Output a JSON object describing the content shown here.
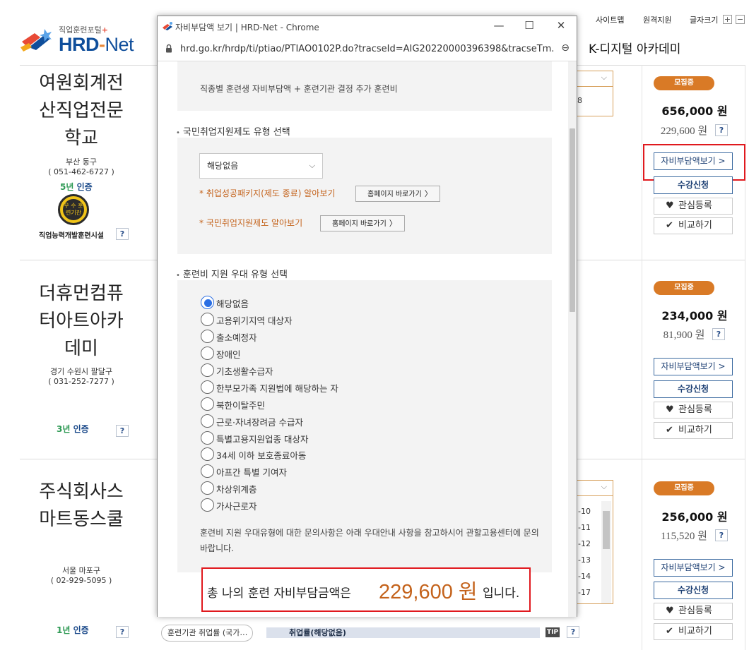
{
  "topbar": {
    "sitemap": "사이트맵",
    "remote": "원격지원",
    "fontsize": "글자크기",
    "plus": "+",
    "minus": "−"
  },
  "logo": {
    "sub": "직업훈련포털",
    "sub_plus": "+",
    "main_a": "HRD",
    "main_dash": "-",
    "main_b": "Net"
  },
  "header_right_title": "K-디지털 아카데미",
  "institutions": [
    {
      "name": "여원회계전산직업전문학교",
      "addr1": "부산 동구",
      "addr2": "( 051-462-6727 )",
      "cert_num": "5년",
      "cert_txt": " 인증",
      "medal_text": "우 수 훈련기관",
      "facility": "직업능력개발훈련시설",
      "q": "?"
    },
    {
      "name": "더휴먼컴퓨터아트아카데미",
      "addr1": "경기 수원시 팔달구",
      "addr2": "( 031-252-7277 )",
      "cert_num": "3년",
      "cert_txt": " 인증",
      "q": "?"
    },
    {
      "name": "주식회사스마트동스쿨",
      "addr1": "서울 마포구",
      "addr2": "( 02-929-5095 )",
      "cert_num": "1년",
      "cert_txt": " 인증",
      "q": "?"
    }
  ],
  "inst_names_lines": [
    [
      "여원회계전",
      "산직업전문",
      "학교"
    ],
    [
      "더휴먼컴퓨",
      "터아트아카",
      "데미"
    ],
    [
      "주식회사스",
      "마트동스쿨"
    ]
  ],
  "courses": [
    {
      "status": "모집중",
      "price": "656,000 원",
      "self_price": "229,600 원",
      "q": "?",
      "btn_view": "자비부담액보기 >",
      "btn_apply": "수강신청",
      "btn_like": "관심등록",
      "btn_compare": "비교하기"
    },
    {
      "status": "모집중",
      "price": "234,000 원",
      "self_price": "81,900 원",
      "q": "?",
      "btn_view": "자비부담액보기 >",
      "btn_apply": "수강신청",
      "btn_like": "관심등록",
      "btn_compare": "비교하기"
    },
    {
      "status": "모집중",
      "price": "256,000 원",
      "self_price": "115,520 원",
      "q": "?",
      "btn_view": "자비부담액보기 >",
      "btn_apply": "수강신청",
      "btn_like": "관심등록",
      "btn_compare": "비교하기"
    }
  ],
  "bg_partial": {
    "first_num": "8",
    "list_nums": [
      "-10",
      "-11",
      "-12",
      "-13",
      "-14",
      "-17"
    ]
  },
  "bottom": {
    "pill": "훈련기관 취업률 (국가…",
    "bar": "취업률(해당없음)",
    "tip": "TIP",
    "q": "?"
  },
  "popup": {
    "title": "자비부담액 보기 | HRD-Net - Chrome",
    "url": "hrd.go.kr/hrdp/ti/ptiao/PTIAO0102P.do?tracseId=AIG20220000396398&tracseTm...",
    "win_min": "—",
    "win_max": "☐",
    "win_close": "✕",
    "zoom_icon": "⊖",
    "intro": "직종별 훈련생 자비부담액 + 훈련기관 결정 추가 훈련비",
    "sec1_title": "국민취업지원제도 유형 선택",
    "select_value": "해당없음",
    "link1": "* 취업성공패키지(제도 종료) 알아보기",
    "link2": "* 국민취업지원제도 알아보기",
    "homepage_btn": "홈페이지 바로가기",
    "sec2_title": "훈련비 지원 우대 유형 선택",
    "radios": [
      "해당없음",
      "고용위기지역 대상자",
      "출소예정자",
      "장애인",
      "기초생활수급자",
      "한부모가족 지원법에 해당하는 자",
      "북한이탈주민",
      "근로·자녀장려금 수급자",
      "특별고용지원업종 대상자",
      "34세 이하 보호종료아동",
      "아프간 특별 기여자",
      "차상위계층",
      "가사근로자"
    ],
    "selected_radio": 0,
    "note": "훈련비 지원 우대유형에 대한 문의사항은 아래 우대안내 사항을 참고하시어 관할고용센터에 문의바랍니다.",
    "total_pre": "총 나의 훈련 자비부담금액은",
    "total_amount": "229,600 원",
    "total_post": "입니다."
  },
  "colors": {
    "accent_orange": "#c4631c",
    "badge_orange": "#d97a26",
    "highlight_red": "#e0191e",
    "radio_blue": "#2a6ee3",
    "brand_blue": "#0f4e9b"
  }
}
